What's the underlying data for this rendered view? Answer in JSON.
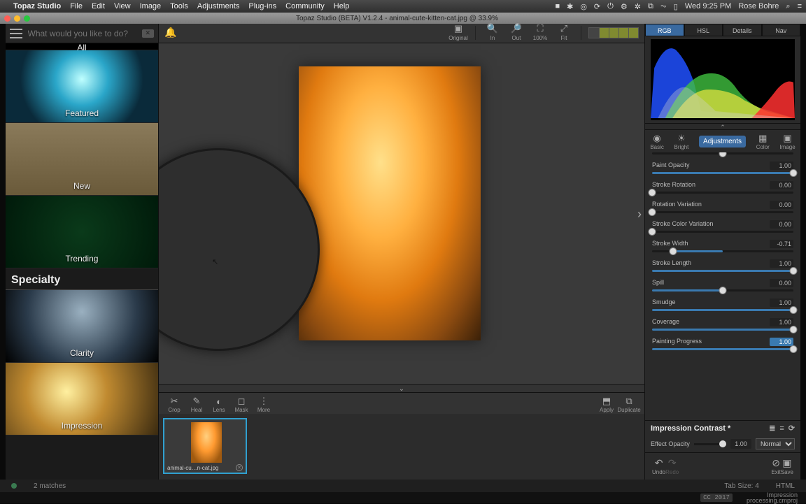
{
  "menubar": {
    "apple": "",
    "app": "Topaz Studio",
    "menus": [
      "File",
      "Edit",
      "View",
      "Image",
      "Tools",
      "Adjustments",
      "Plug-ins",
      "Community",
      "Help"
    ],
    "status_icons": [
      "■",
      "✱",
      "◎",
      "⟳",
      "⏻",
      "⚙",
      "✲",
      "⧉",
      "✶",
      "⏦",
      "▯"
    ],
    "clock": "Wed 9:25 PM",
    "user": "Rose Bohre",
    "right_icons": [
      "⌕",
      "≡"
    ]
  },
  "doc_title": "Topaz Studio (BETA) V1.2.4 - animal-cute-kitten-cat.jpg @ 33.9%",
  "search_placeholder": "What would you like to do?",
  "left": {
    "all": "All",
    "cats": [
      {
        "label": "Featured",
        "cls": "th-featured"
      },
      {
        "label": "New",
        "cls": "th-new"
      },
      {
        "label": "Trending",
        "cls": "th-trend"
      }
    ],
    "section": "Specialty",
    "specialty": [
      {
        "label": "Clarity",
        "cls": "th-clarity"
      },
      {
        "label": "Impression",
        "cls": "th-impr"
      }
    ]
  },
  "center_tools_top": {
    "original": "Original",
    "in": "In",
    "out": "Out",
    "hundred": "100%",
    "fit": "Fit"
  },
  "center_tools_bottom": {
    "crop": "Crop",
    "heal": "Heal",
    "lens": "Lens",
    "mask": "Mask",
    "more": "More",
    "apply": "Apply",
    "duplicate": "Duplicate"
  },
  "frame_label": "animal-cu…n-cat.jpg",
  "right": {
    "tabs": [
      "RGB",
      "HSL",
      "Details",
      "Nav"
    ],
    "active_tab": 0,
    "modes_left": "Basic",
    "modes_bright": "Bright",
    "modes_center": "Adjustments",
    "modes_color": "Color",
    "modes_image": "Image",
    "sliders": [
      {
        "name": "Paint Opacity",
        "val": "1.00",
        "pct": 100
      },
      {
        "name": "Stroke Rotation",
        "val": "0.00",
        "pct": 0
      },
      {
        "name": "Rotation Variation",
        "val": "0.00",
        "pct": 0
      },
      {
        "name": "Stroke Color Variation",
        "val": "0.00",
        "pct": 0
      },
      {
        "name": "Stroke Width",
        "val": "-0.71",
        "pct": 15,
        "centered": true
      },
      {
        "name": "Stroke Length",
        "val": "1.00",
        "pct": 100
      },
      {
        "name": "Spill",
        "val": "0.00",
        "pct": 50,
        "centerknob": true
      },
      {
        "name": "Smudge",
        "val": "1.00",
        "pct": 100
      },
      {
        "name": "Coverage",
        "val": "1.00",
        "pct": 100
      },
      {
        "name": "Painting Progress",
        "val": "1.00",
        "pct": 100,
        "hl": true
      }
    ],
    "effect_name": "Impression Contrast *",
    "effect_opacity_label": "Effect Opacity",
    "effect_opacity_val": "1.00",
    "blend_mode": "Normal",
    "actions": {
      "undo": "Undo",
      "redo": "Redo",
      "exit": "Exit",
      "save": "Save"
    }
  },
  "footer": {
    "matches": "2 matches",
    "tabsize": "Tab Size: 4",
    "lang": "HTML"
  },
  "subfooter": {
    "cc": "CC 2017",
    "proj1": "Impression",
    "proj2": "processing.cmproj"
  }
}
